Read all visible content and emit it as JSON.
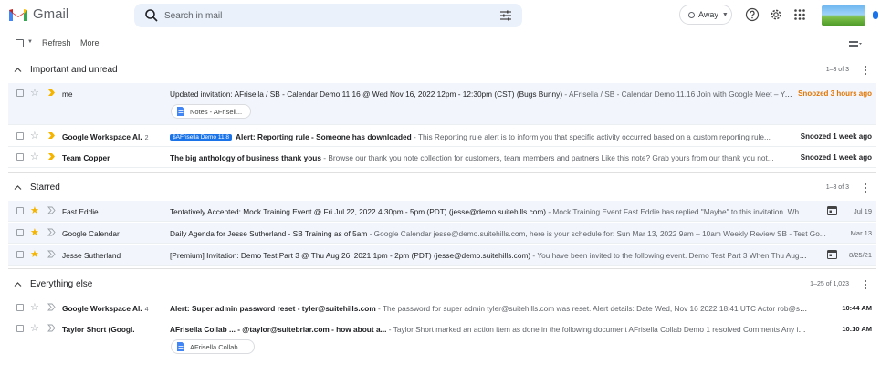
{
  "header": {
    "app_name": "Gmail",
    "search_placeholder": "Search in mail",
    "status": "Away",
    "icons": [
      "gmail-logo-icon",
      "search-icon",
      "tune-icon",
      "help-icon",
      "gear-icon",
      "apps-grid-icon"
    ]
  },
  "toolbar": {
    "refresh": "Refresh",
    "more": "More"
  },
  "sections": {
    "important": {
      "title": "Important and unread",
      "count": "1–3 of 3"
    },
    "starred": {
      "title": "Starred",
      "count": "1–3 of 3"
    },
    "everything": {
      "title": "Everything else",
      "count": "1–25 of 1,023"
    }
  },
  "emails": {
    "important": [
      {
        "sender": "me",
        "count": "",
        "label": "",
        "subject": "Updated invitation: AFrisella / SB - Calendar Demo 11.16 @ Wed Nov 16, 2022 12pm - 12:30pm (CST) (Bugs Bunny)",
        "snippet": " - AFrisella / SB - Calendar Demo 11.16 Join with Google Meet – Yo...",
        "date": "Snoozed 3 hours ago",
        "attachment": "Notes - AFrisell..."
      },
      {
        "sender": "Google Workspace Al.",
        "count": "2",
        "label": "$AFrisella Demo 11.8",
        "subject": "Alert: Reporting rule - Someone has downloaded",
        "snippet": " - This Reporting rule alert is to inform you that specific activity occurred based on a custom reporting rule...",
        "date": "Snoozed 1 week ago"
      },
      {
        "sender": "Team Copper",
        "count": "",
        "label": "",
        "subject": "The big anthology of business thank yous",
        "snippet": " - Browse our thank you note collection for customers, team members and partners Like this note? Grab yours from our thank you not...",
        "date": "Snoozed 1 week ago"
      }
    ],
    "starred": [
      {
        "sender": "Fast Eddie",
        "subject": "Tentatively Accepted: Mock Training Event @ Fri Jul 22, 2022 4:30pm - 5pm (PDT) (jesse@demo.suitehills.com)",
        "snippet": " - Mock Training Event Fast Eddie has replied \"Maybe\" to this invitation. When F...",
        "date": "Jul 19"
      },
      {
        "sender": "Google Calendar",
        "subject": "Daily Agenda for Jesse Sutherland - SB Training as of 5am",
        "snippet": " - Google Calendar jesse@demo.suitehills.com, here is your schedule for: Sun Mar 13, 2022 9am – 10am Weekly Review SB - Test Go...",
        "date": "Mar 13"
      },
      {
        "sender": "Jesse Sutherland",
        "subject": "[Premium] Invitation: Demo Test Part 3 @ Thu Aug 26, 2021 1pm - 2pm (PDT) (jesse@demo.suitehills.com)",
        "snippet": " - You have been invited to the following event. Demo Test Part 3 When Thu Aug 26, 2...",
        "date": "8/25/21"
      }
    ],
    "everything": [
      {
        "sender": "Google Workspace Al.",
        "count": "4",
        "subject": "Alert: Super admin password reset - tyler@suitehills.com",
        "snippet": " - The password for super admin tyler@suitehills.com was reset. Alert details: Date Wed, Nov 16 2022 18:41 UTC Actor rob@suiteh...",
        "date": "10:44 AM"
      },
      {
        "sender": "Taylor Short (Googl.",
        "count": "",
        "subject": "AFrisella Collab ... - @taylor@suitebriar.com - how about a...",
        "snippet": " - Taylor Short marked an action item as done in the following document AFrisella Collab Demo 1 resolved Comments Any ima...",
        "date": "10:10 AM",
        "attachment": "AFrisella Collab ..."
      }
    ]
  }
}
